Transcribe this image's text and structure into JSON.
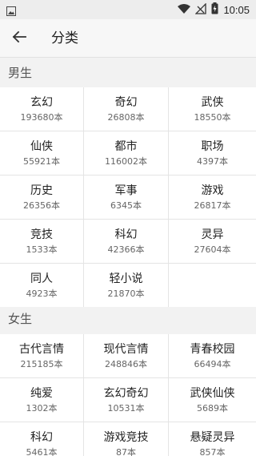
{
  "status_bar": {
    "time": "10:05"
  },
  "header": {
    "title": "分类"
  },
  "sections": [
    {
      "title": "男生",
      "items": [
        {
          "name": "玄幻",
          "count": "193680本"
        },
        {
          "name": "奇幻",
          "count": "26808本"
        },
        {
          "name": "武侠",
          "count": "18550本"
        },
        {
          "name": "仙侠",
          "count": "55921本"
        },
        {
          "name": "都市",
          "count": "116002本"
        },
        {
          "name": "职场",
          "count": "4397本"
        },
        {
          "name": "历史",
          "count": "26356本"
        },
        {
          "name": "军事",
          "count": "6345本"
        },
        {
          "name": "游戏",
          "count": "26817本"
        },
        {
          "name": "竞技",
          "count": "1533本"
        },
        {
          "name": "科幻",
          "count": "42366本"
        },
        {
          "name": "灵异",
          "count": "27604本"
        },
        {
          "name": "同人",
          "count": "4923本"
        },
        {
          "name": "轻小说",
          "count": "21870本"
        }
      ]
    },
    {
      "title": "女生",
      "items": [
        {
          "name": "古代言情",
          "count": "215185本"
        },
        {
          "name": "现代言情",
          "count": "248846本"
        },
        {
          "name": "青春校园",
          "count": "66494本"
        },
        {
          "name": "纯爱",
          "count": "1302本"
        },
        {
          "name": "玄幻奇幻",
          "count": "10531本"
        },
        {
          "name": "武侠仙侠",
          "count": "5689本"
        },
        {
          "name": "科幻",
          "count": "5461本"
        },
        {
          "name": "游戏竞技",
          "count": "87本"
        },
        {
          "name": "悬疑灵异",
          "count": "857本"
        }
      ]
    }
  ]
}
